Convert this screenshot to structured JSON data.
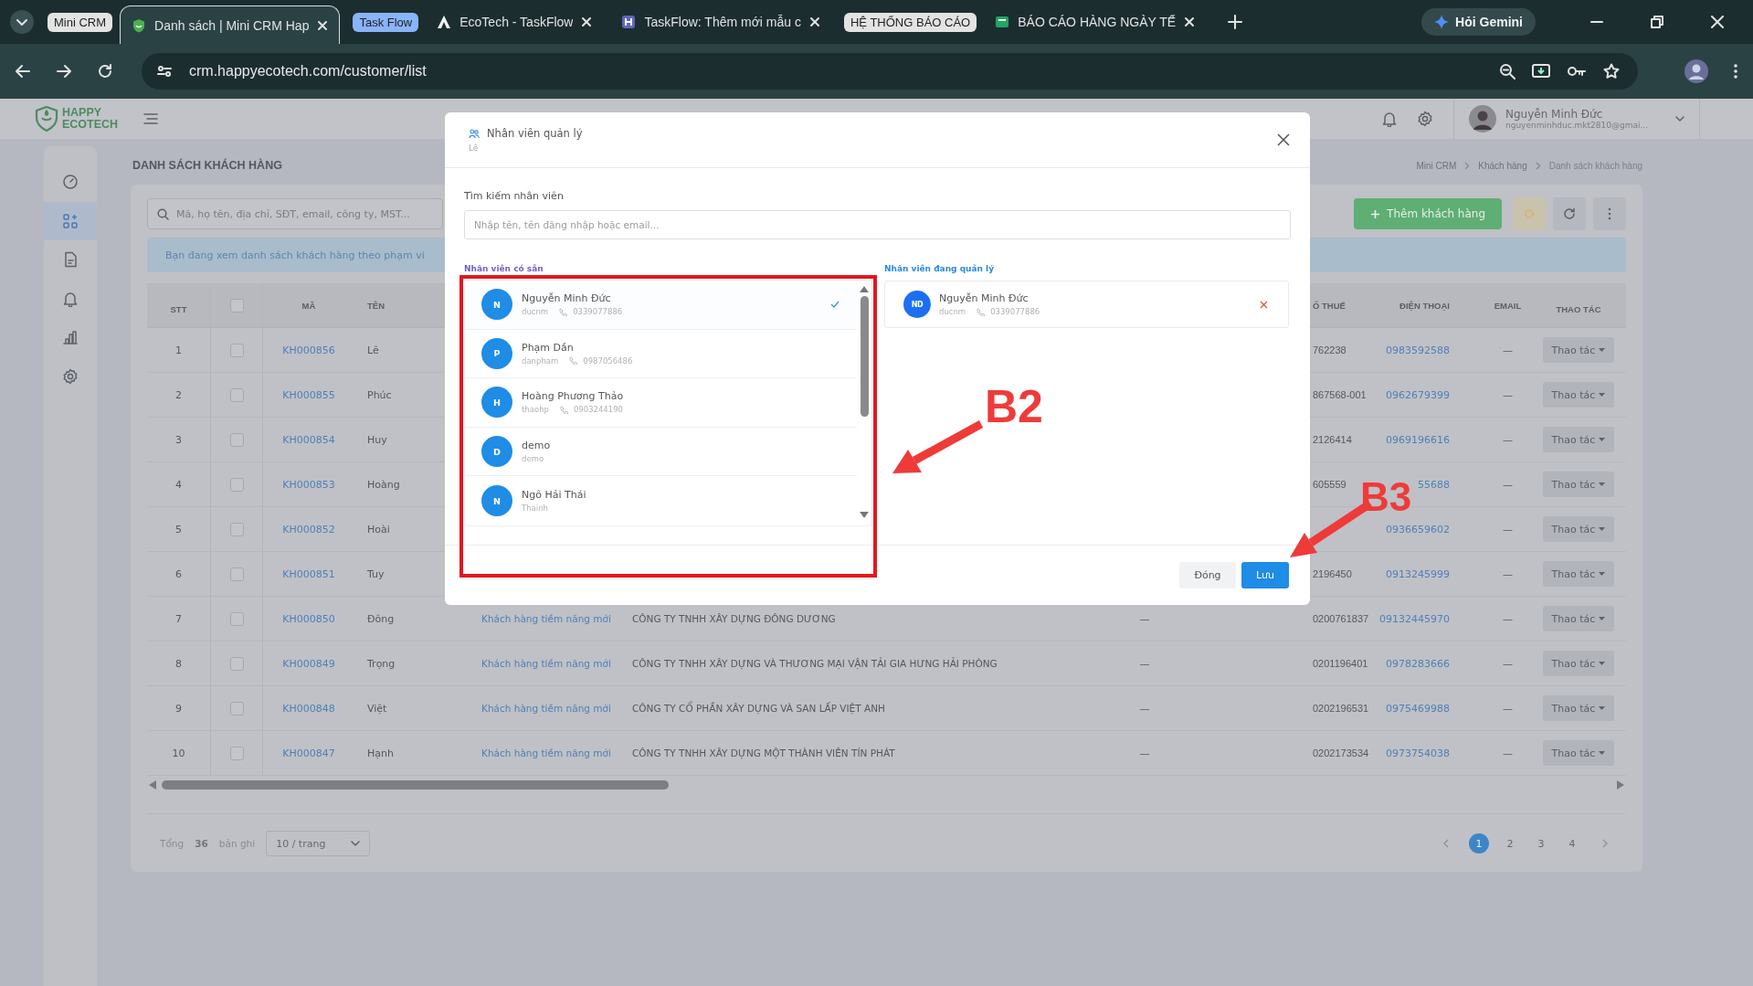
{
  "browser": {
    "tab_strip": [
      {
        "kind": "group",
        "label": "Mini CRM",
        "color": "#e3e3e3"
      },
      {
        "kind": "tab",
        "title": "Danh sách | Mini CRM Hap",
        "selected": true
      },
      {
        "kind": "group",
        "label": "Task Flow",
        "color": "#8ab4f8"
      },
      {
        "kind": "tab",
        "title": "EcoTech - TaskFlow",
        "selected": false
      },
      {
        "kind": "tab",
        "title": "TaskFlow: Thêm mới mẫu c",
        "selected": false
      },
      {
        "kind": "group",
        "label": "HỆ THỐNG BÁO CÁO",
        "color": "#e3e3e3"
      },
      {
        "kind": "tab",
        "title": "BÁO CÁO HÀNG NGÀY TẾ",
        "selected": false
      }
    ],
    "gemini_button": "Hỏi Gemini",
    "address": "crm.happyecotech.com/customer/list"
  },
  "app": {
    "logo": {
      "line_1": "HAPPY",
      "line_2": "ECOTECH"
    },
    "user": {
      "name": "Nguyễn Minh Đức",
      "email": "nguyenminhduc.mkt2810@gmai..."
    },
    "sidebar": {
      "items": [
        {
          "selected": false
        },
        {
          "selected": true
        },
        {
          "selected": false
        },
        {
          "selected": false
        },
        {
          "selected": false
        },
        {
          "selected": false
        }
      ]
    },
    "page_title": "DANH SÁCH KHÁCH HÀNG",
    "breadcrumb": [
      {
        "label": "Mini CRM",
        "current": false
      },
      {
        "label": "Khách hàng",
        "current": false
      },
      {
        "label": "Danh sách khách hàng",
        "current": true
      }
    ],
    "search": {
      "placeholder": "Mã, họ tên, địa chỉ, SĐT, email, công ty, MST..."
    },
    "add_button": "Thêm khách hàng",
    "notice": "Bạn đang xem danh sách khách hàng theo phạm vi",
    "table": {
      "columns": [
        {
          "kind": "stt",
          "label": "STT"
        },
        {
          "kind": "check",
          "checked": false
        },
        {
          "kind": "code",
          "label": "MÃ"
        },
        {
          "kind": "name",
          "label": "TÊN"
        },
        {
          "kind": "type"
        },
        {
          "kind": "company"
        },
        {
          "kind": "column_7"
        },
        {
          "kind": "tax",
          "label": "Ố THUẾ"
        },
        {
          "kind": "phone",
          "label": "ĐIỆN THOẠI"
        },
        {
          "kind": "email",
          "label": "EMAIL"
        },
        {
          "kind": "actions",
          "label": "THAO TÁC"
        }
      ],
      "rows": [
        {
          "stt": "1",
          "checked": false,
          "code": "KH000856",
          "name": "Lê",
          "tax": "762238",
          "phone": "0983592588",
          "email": "—",
          "actions": "Thao tác"
        },
        {
          "stt": "2",
          "checked": false,
          "code": "KH000855",
          "name": "Phúc",
          "tax": "867568-001",
          "phone": "0962679399",
          "email": "—",
          "actions": "Thao tác"
        },
        {
          "stt": "3",
          "checked": false,
          "code": "KH000854",
          "name": "Huy",
          "tax": "2126414",
          "phone": "0969196616",
          "email": "—",
          "actions": "Thao tác"
        },
        {
          "stt": "4",
          "checked": false,
          "code": "KH000853",
          "name": "Hoàng",
          "tax": "605559",
          "phone": "55688",
          "email": "—",
          "actions": "Thao tác"
        },
        {
          "stt": "5",
          "checked": false,
          "code": "KH000852",
          "name": "Hoài",
          "phone": "0936659602",
          "email": "—",
          "actions": "Thao tác"
        },
        {
          "stt": "6",
          "checked": false,
          "code": "KH000851",
          "name": "Tuy",
          "tax": "2196450",
          "phone": "0913245999",
          "email": "—",
          "actions": "Thao tác"
        },
        {
          "stt": "7",
          "checked": false,
          "code": "KH000850",
          "name": "Đông",
          "type": "Khách hàng tiềm năng mới",
          "company": "CÔNG TY TNHH XÂY DỰNG ĐÔNG DƯƠNG",
          "column_7": "—",
          "tax": "0200761837",
          "phone": "09132445970",
          "email": "—",
          "actions": "Thao tác"
        },
        {
          "stt": "8",
          "checked": false,
          "code": "KH000849",
          "name": "Trọng",
          "type": "Khách hàng tiềm năng mới",
          "company": "CÔNG TY TNHH XÂY DỰNG VÀ THƯƠNG MẠI VẬN TẢI GIA HƯNG HẢI PHÒNG",
          "column_7": "—",
          "tax": "0201196401",
          "phone": "0978283666",
          "email": "—",
          "actions": "Thao tác"
        },
        {
          "stt": "9",
          "checked": false,
          "code": "KH000848",
          "name": "Việt",
          "type": "Khách hàng tiềm năng mới",
          "company": "CÔNG TY CỔ PHẦN XÂY DỰNG VÀ SAN LẤP VIỆT ANH",
          "column_7": "—",
          "tax": "0202196531",
          "phone": "0975469988",
          "email": "—",
          "actions": "Thao tác"
        },
        {
          "stt": "10",
          "checked": false,
          "code": "KH000847",
          "name": "Hạnh",
          "type": "Khách hàng tiềm năng mới",
          "company": "CÔNG TY TNHH XÂY DỰNG MỘT THÀNH VIÊN TÍN PHÁT",
          "column_7": "—",
          "tax": "0202173534",
          "phone": "0973754038",
          "email": "—",
          "actions": "Thao tác"
        }
      ]
    },
    "footer": {
      "total_label": "Tổng",
      "total": "36",
      "unit": "bản ghi",
      "page_size": "10 / trang",
      "pages": [
        {
          "label": "1",
          "selected": true
        },
        {
          "label": "2",
          "selected": false
        },
        {
          "label": "3",
          "selected": false
        },
        {
          "label": "4",
          "selected": false
        }
      ]
    }
  },
  "modal": {
    "title": "Nhân viên quản lý",
    "subtitle": "Lê",
    "search_label": "Tìm kiếm nhân viên",
    "search_placeholder": "Nhập tên, tên đăng nhập hoặc email...",
    "available_label": "Nhân viên có sẵn",
    "available": [
      {
        "initial": "N",
        "name": "Nguyễn Minh Đức",
        "username": "ducnm",
        "phone": "0339077886",
        "selected": true
      },
      {
        "initial": "P",
        "name": "Phạm Dần",
        "username": "danpham",
        "phone": "0987056486",
        "selected": false
      },
      {
        "initial": "H",
        "name": "Hoàng Phương Thảo",
        "username": "thaohp",
        "phone": "0903244190",
        "selected": false
      },
      {
        "initial": "D",
        "name": "demo",
        "username": "demo",
        "selected": false
      },
      {
        "initial": "N",
        "name": "Ngô Hải Thái",
        "username": "Thainh",
        "selected": false
      }
    ],
    "managed_label": "Nhân viên đang quản lý",
    "managed": [
      {
        "initials": "ND",
        "name": "Nguyễn Minh Đức",
        "username": "ducnm",
        "phone": "0339077886"
      }
    ],
    "buttons": [
      {
        "kind": "secondary",
        "label": "Đóng"
      },
      {
        "kind": "primary",
        "label": "Lưu"
      }
    ]
  },
  "annotations": [
    {
      "kind": "box"
    },
    {
      "kind": "arrow",
      "label": "B2"
    },
    {
      "kind": "arrow",
      "label": "B3"
    }
  ]
}
